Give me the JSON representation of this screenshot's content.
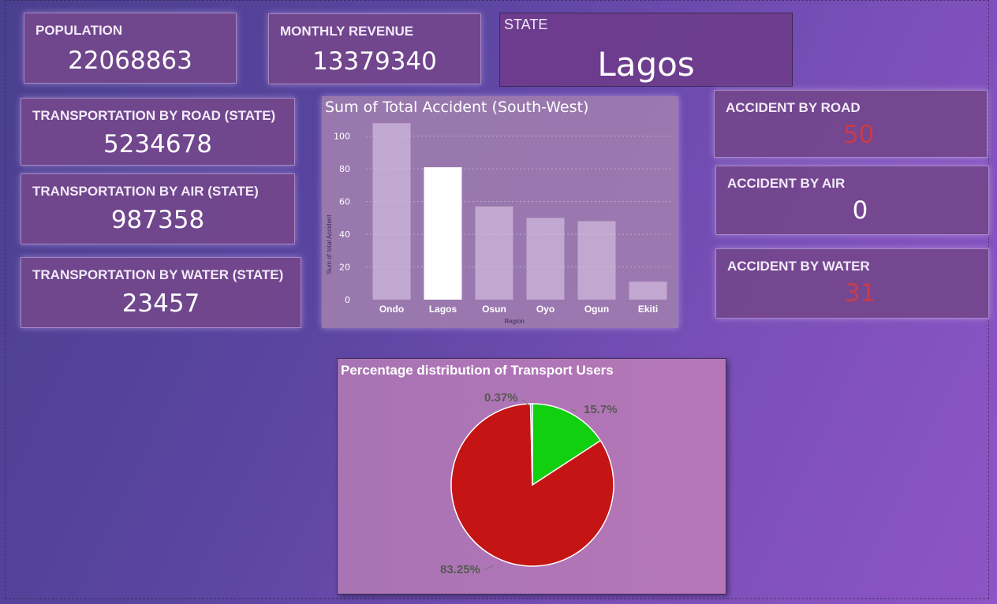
{
  "kpis": {
    "population": {
      "label": "POPULATION",
      "value": "22068863"
    },
    "monthly_revenue": {
      "label": "MONTHLY REVENUE",
      "value": "13379340"
    },
    "state": {
      "label": "STATE",
      "value": "Lagos"
    },
    "road": {
      "label": "TRANSPORTATION BY ROAD (STATE)",
      "value": "5234678"
    },
    "air": {
      "label": "TRANSPORTATION BY AIR (STATE)",
      "value": "987358"
    },
    "water": {
      "label": "TRANSPORTATION BY WATER (STATE)",
      "value": "23457"
    },
    "acc_road": {
      "label": "ACCIDENT BY ROAD",
      "value": "50"
    },
    "acc_air": {
      "label": "ACCIDENT BY AIR",
      "value": "0"
    },
    "acc_water": {
      "label": "ACCIDENT BY WATER",
      "value": "31"
    }
  },
  "colors": {
    "highlight_red": "#c83c4a",
    "pie_red": "#c41414",
    "pie_green": "#10d010",
    "pie_blue": "#3a7ad0"
  },
  "chart_data": [
    {
      "type": "bar",
      "title": "Sum of Total Accident (South-West)",
      "xlabel": "Region",
      "ylabel": "Sum of total Accident",
      "categories": [
        "Ondo",
        "Lagos",
        "Osun",
        "Oyo",
        "Ogun",
        "Ekiti"
      ],
      "values": [
        108,
        81,
        57,
        50,
        48,
        11
      ],
      "highlighted": "Lagos",
      "ylim": [
        0,
        110
      ],
      "yticks": [
        "0",
        "20",
        "40",
        "60",
        "80",
        "100"
      ],
      "grid": true
    },
    {
      "type": "pie",
      "title": "Percentage distribution of Transport Users",
      "slices": [
        {
          "label": "15.7%",
          "value": 15.7,
          "color": "#10d010"
        },
        {
          "label": "83.25%",
          "value": 83.25,
          "color": "#c41414"
        },
        {
          "label": "0.37%",
          "value": 0.37,
          "color": "#3a7ad0"
        }
      ]
    }
  ]
}
